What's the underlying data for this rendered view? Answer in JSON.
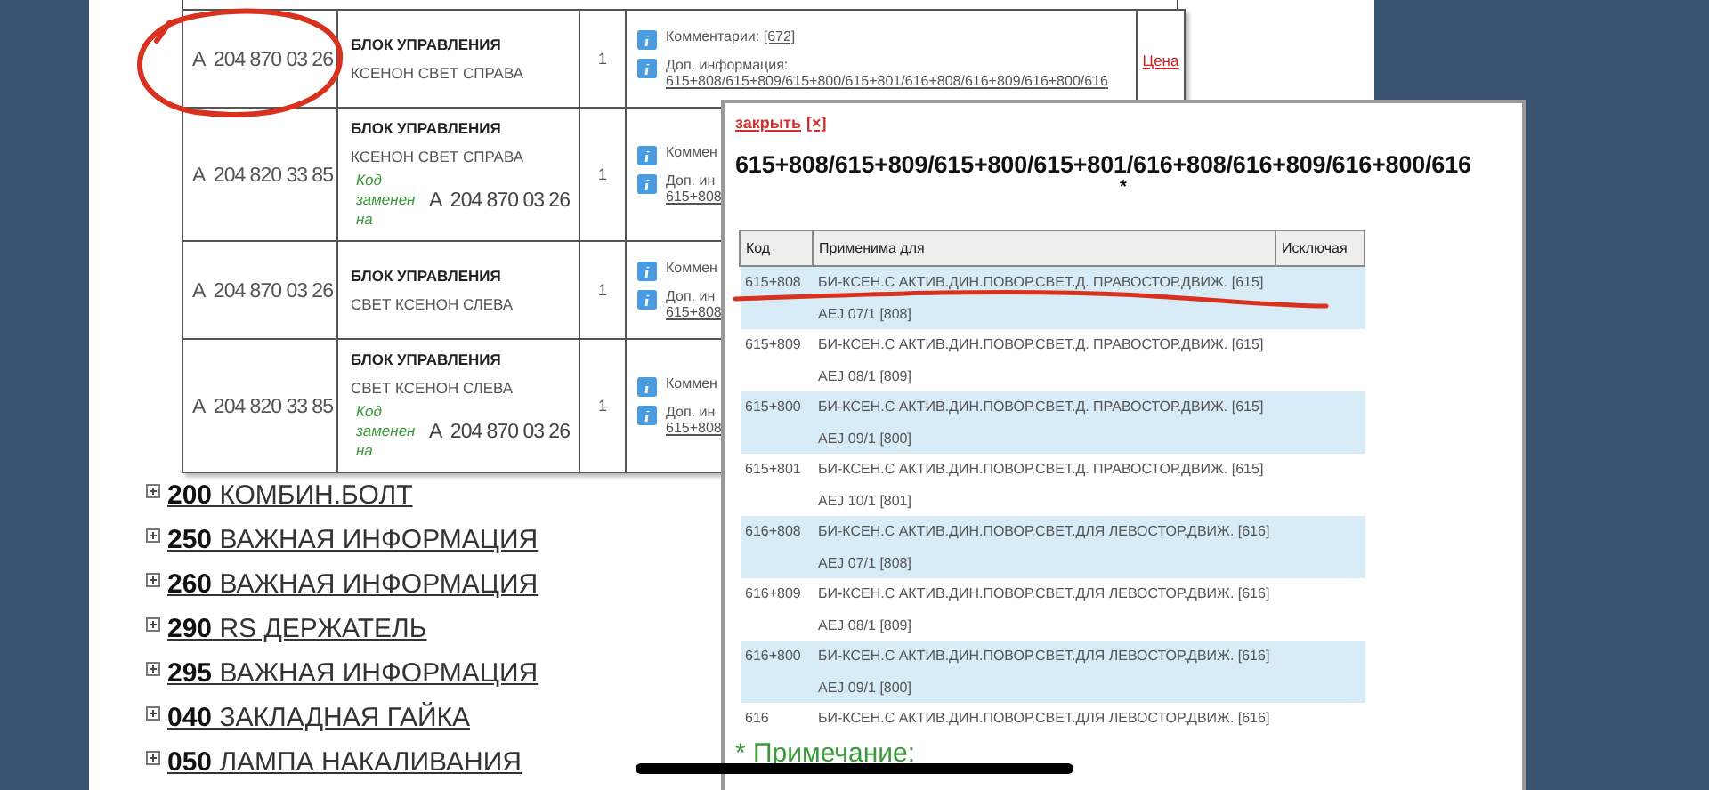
{
  "parts_table": {
    "rows": [
      {
        "code": "A  204 870 03 26",
        "name": "БЛОК УПРАВЛЕНИЯ",
        "description": "КСЕНОН СВЕТ СПРАВА",
        "quantity": "1",
        "comment_label": "Комментарии:",
        "comment_link": "[672]",
        "info_label": "Доп. информация:",
        "info_value": "615+808/615+809/615+800/615+801/616+808/616+809/616+800/616",
        "price_link": "Цена"
      },
      {
        "code": "A  204 820 33 85",
        "name": "БЛОК УПРАВЛЕНИЯ",
        "description": "КСЕНОН СВЕТ СПРАВА",
        "replaced_label": "Код заменен на",
        "replaced_by": "A  204 870 03 26",
        "quantity": "1",
        "comment_label": "Коммен",
        "info_label": "Доп. ин",
        "info_value": "615+808"
      },
      {
        "code": "A  204 870 03 26",
        "name": "БЛОК УПРАВЛЕНИЯ",
        "description": "СВЕТ КСЕНОН СЛЕВА",
        "quantity": "1",
        "comment_label": "Коммен",
        "info_label": "Доп. ин",
        "info_value": "615+808"
      },
      {
        "code": "A  204 820 33 85",
        "name": "БЛОК УПРАВЛЕНИЯ",
        "description": "СВЕТ КСЕНОН СЛЕВА",
        "replaced_label": "Код заменен на",
        "replaced_by": "A  204 870 03 26",
        "quantity": "1",
        "comment_label": "Коммен",
        "info_label": "Доп. ин",
        "info_value": "615+808"
      }
    ]
  },
  "sections": [
    {
      "number": "200",
      "title": "КОМБИН.БОЛТ"
    },
    {
      "number": "250",
      "title": "ВАЖНАЯ ИНФОРМАЦИЯ"
    },
    {
      "number": "260",
      "title": "ВАЖНАЯ ИНФОРМАЦИЯ"
    },
    {
      "number": "290",
      "title": "RS ДЕРЖАТЕЛЬ"
    },
    {
      "number": "295",
      "title": "ВАЖНАЯ ИНФОРМАЦИЯ"
    },
    {
      "number": "040",
      "title": "ЗАКЛАДНАЯ ГАЙКА"
    },
    {
      "number": "050",
      "title": "ЛАМПА НАКАЛИВАНИЯ"
    }
  ],
  "popup": {
    "close_link": "закрыть",
    "close_icon": "[×]",
    "title": "615+808/615+809/615+800/615+801/616+808/616+809/616+800/616",
    "title_mark": "*",
    "table": {
      "columns": [
        "Код",
        "Применима для",
        "Исключая"
      ],
      "rows": [
        {
          "code": "615+808",
          "lines": [
            "БИ-КСЕН.С АКТИВ.ДИН.ПОВОР.СВЕТ.Д. ПРАВОСТОР.ДВИЖ. [615]",
            "AEJ 07/1 [808]"
          ]
        },
        {
          "code": "615+809",
          "lines": [
            "БИ-КСЕН.С АКТИВ.ДИН.ПОВОР.СВЕТ.Д. ПРАВОСТОР.ДВИЖ. [615]",
            "AEJ 08/1 [809]"
          ]
        },
        {
          "code": "615+800",
          "lines": [
            "БИ-КСЕН.С АКТИВ.ДИН.ПОВОР.СВЕТ.Д. ПРАВОСТОР.ДВИЖ. [615]",
            "AEJ 09/1 [800]"
          ]
        },
        {
          "code": "615+801",
          "lines": [
            "БИ-КСЕН.С АКТИВ.ДИН.ПОВОР.СВЕТ.Д. ПРАВОСТОР.ДВИЖ. [615]",
            "AEJ 10/1 [801]"
          ]
        },
        {
          "code": "616+808",
          "lines": [
            "БИ-КСЕН.С АКТИВ.ДИН.ПОВОР.СВЕТ.ДЛЯ ЛЕВОСТОР.ДВИЖ. [616]",
            "AEJ 07/1 [808]"
          ]
        },
        {
          "code": "616+809",
          "lines": [
            "БИ-КСЕН.С АКТИВ.ДИН.ПОВОР.СВЕТ.ДЛЯ ЛЕВОСТОР.ДВИЖ. [616]",
            "AEJ 08/1 [809]"
          ]
        },
        {
          "code": "616+800",
          "lines": [
            "БИ-КСЕН.С АКТИВ.ДИН.ПОВОР.СВЕТ.ДЛЯ ЛЕВОСТОР.ДВИЖ. [616]",
            "AEJ 09/1 [800]"
          ]
        },
        {
          "code": "616",
          "lines": [
            "БИ-КСЕН.С АКТИВ.ДИН.ПОВОР.СВЕТ.ДЛЯ ЛЕВОСТОР.ДВИЖ. [616]"
          ]
        }
      ]
    },
    "note_title": "* Примечание:"
  }
}
